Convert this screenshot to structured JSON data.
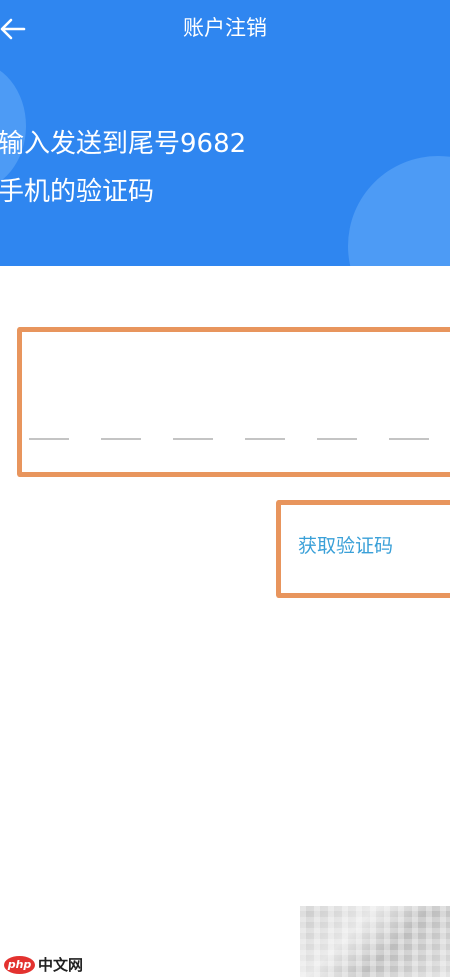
{
  "colors": {
    "header_bg": "#2f86f0",
    "header_blob": "#4d9bf5",
    "highlight_border": "#e8955d",
    "link": "#3aa0d8",
    "code_slot": "#c4c4c4"
  },
  "icons": {
    "back": "arrow-left-icon"
  },
  "nav": {
    "title": "账户注销"
  },
  "prompt": {
    "line1": "输入发送到尾号9682",
    "line2": "手机的验证码"
  },
  "code_input": {
    "slot_count": 6
  },
  "get_code": {
    "label": "获取验证码"
  },
  "watermark": {
    "logo_text": "php",
    "site_text": "中文网"
  }
}
